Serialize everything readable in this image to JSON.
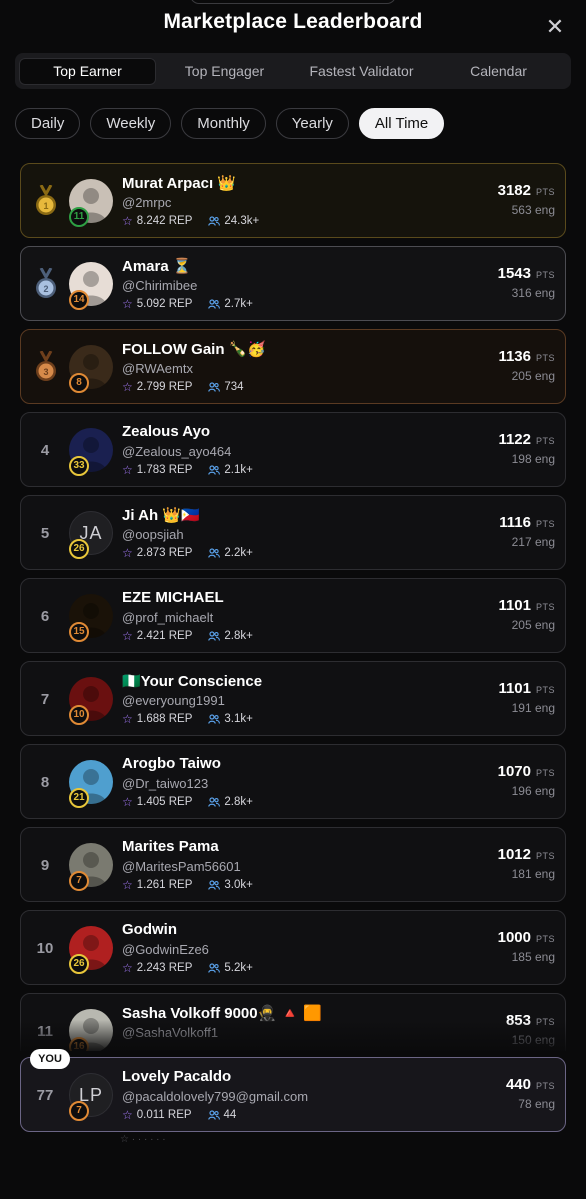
{
  "title": "Marketplace Leaderboard",
  "tabs": [
    "Top Earner",
    "Top Engager",
    "Fastest Validator",
    "Calendar"
  ],
  "active_tab": 0,
  "periods": [
    "Daily",
    "Weekly",
    "Monthly",
    "Yearly",
    "All Time"
  ],
  "active_period": 4,
  "pts_unit": "PTS",
  "eng_unit": "eng",
  "rows": [
    {
      "rank": "1",
      "medal": "gold",
      "name": "Murat Arpacı 👑",
      "handle": "@2mrpc",
      "rep": "8.242 REP",
      "followers": "24.3k+",
      "level": "11",
      "level_color": "#2ea043",
      "pts": "3182",
      "eng": "563"
    },
    {
      "rank": "2",
      "medal": "silver",
      "name": "Amara ⏳",
      "handle": "@Chirimibee",
      "rep": "5.092 REP",
      "followers": "2.7k+",
      "level": "14",
      "level_color": "#e08a35",
      "pts": "1543",
      "eng": "316"
    },
    {
      "rank": "3",
      "medal": "bronze",
      "name": "FOLLOW Gain 🍾🥳",
      "handle": "@RWAemtx",
      "rep": "2.799 REP",
      "followers": "734",
      "level": "8",
      "level_color": "#e08a35",
      "pts": "1136",
      "eng": "205"
    },
    {
      "rank": "4",
      "medal": "",
      "name": "Zealous Ayo",
      "handle": "@Zealous_ayo464",
      "rep": "1.783 REP",
      "followers": "2.1k+",
      "level": "33",
      "level_color": "#e8c63a",
      "pts": "1122",
      "eng": "198"
    },
    {
      "rank": "5",
      "medal": "",
      "name": "Ji Ah 👑🇵🇭",
      "handle": "@oopsjiah",
      "rep": "2.873 REP",
      "followers": "2.2k+",
      "level": "26",
      "level_color": "#e8c63a",
      "pts": "1116",
      "eng": "217",
      "initials": "JA"
    },
    {
      "rank": "6",
      "medal": "",
      "name": "EZE MICHAEL",
      "handle": "@prof_michaelt",
      "rep": "2.421 REP",
      "followers": "2.8k+",
      "level": "15",
      "level_color": "#e08a35",
      "pts": "1101",
      "eng": "205"
    },
    {
      "rank": "7",
      "medal": "",
      "name": "🇳🇬Your Conscience",
      "handle": "@everyoung1991",
      "rep": "1.688 REP",
      "followers": "3.1k+",
      "level": "10",
      "level_color": "#e08a35",
      "pts": "1101",
      "eng": "191"
    },
    {
      "rank": "8",
      "medal": "",
      "name": "Arogbo Taiwo",
      "handle": "@Dr_taiwo123",
      "rep": "1.405 REP",
      "followers": "2.8k+",
      "level": "21",
      "level_color": "#e8c63a",
      "pts": "1070",
      "eng": "196"
    },
    {
      "rank": "9",
      "medal": "",
      "name": "Marites Pama",
      "handle": "@MaritesPam56601",
      "rep": "1.261 REP",
      "followers": "3.0k+",
      "level": "7",
      "level_color": "#e08a35",
      "pts": "1012",
      "eng": "181"
    },
    {
      "rank": "10",
      "medal": "",
      "name": "Godwin",
      "handle": "@GodwinEze6",
      "rep": "2.243 REP",
      "followers": "5.2k+",
      "level": "26",
      "level_color": "#e8c63a",
      "pts": "1000",
      "eng": "185"
    },
    {
      "rank": "11",
      "medal": "",
      "name": "Sasha Volkoff 9000🥷 🔺 🟧",
      "handle": "@SashaVolkoff1",
      "rep": "",
      "followers": "",
      "level": "16",
      "level_color": "#e08a35",
      "pts": "853",
      "eng": "150"
    }
  ],
  "you": {
    "badge": "YOU",
    "rank": "77",
    "name": "Lovely Pacaldo",
    "handle": "@pacaldolovely799@gmail.com",
    "rep": "0.011 REP",
    "followers": "44",
    "level": "7",
    "level_color": "#e08a35",
    "pts": "440",
    "eng": "78",
    "initials": "LP"
  },
  "avatar_colors": [
    "#c9c0b6",
    "#e7ddd6",
    "#3a2a1a",
    "#1a2050",
    "",
    "#1a1208",
    "#6a1010",
    "#4f9fcf",
    "#7a7a70",
    "#b02020",
    "#b8b8b0"
  ]
}
